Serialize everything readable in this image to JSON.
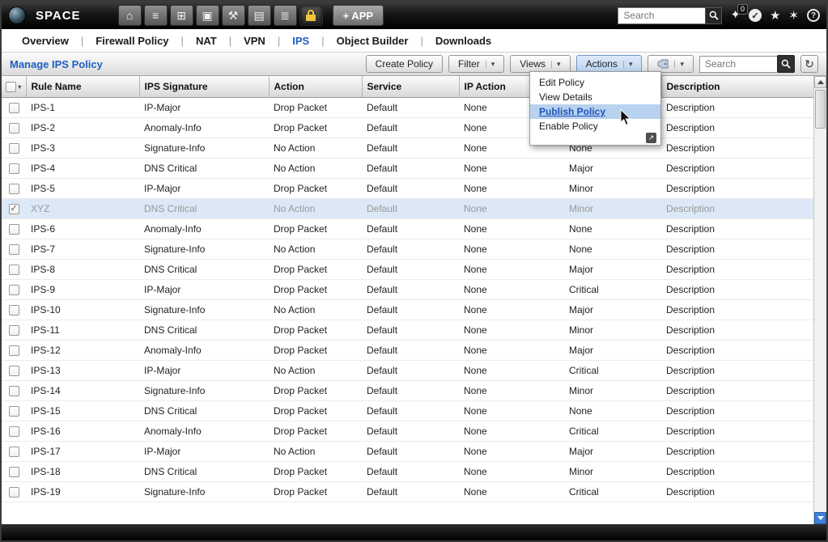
{
  "topbar": {
    "brand": "SPACE",
    "app_button": "+ APP",
    "search_placeholder": "Search",
    "badge": "0"
  },
  "icons": {
    "home": "⌂",
    "list": "≡",
    "screens": "⊞",
    "snapshot": "▣",
    "tools": "⚒",
    "report": "▤",
    "rack": "≣",
    "sparkle": "✦",
    "check": "✓",
    "star": "★",
    "star2": "✶",
    "help": "?",
    "refresh": "↻",
    "dropdown_arrow": "▾",
    "external": "↗"
  },
  "nav": {
    "separator": "|",
    "items": [
      {
        "label": "Overview",
        "active": false
      },
      {
        "label": "Firewall Policy",
        "active": false
      },
      {
        "label": "NAT",
        "active": false
      },
      {
        "label": "VPN",
        "active": false
      },
      {
        "label": "IPS",
        "active": true
      },
      {
        "label": "Object Builder",
        "active": false
      },
      {
        "label": "Downloads",
        "active": false
      }
    ]
  },
  "toolbar": {
    "title": "Manage IPS Policy",
    "create_button": "Create Policy",
    "filter_button": "Filter",
    "views_button": "Views",
    "actions_button": "Actions",
    "search_placeholder": "Search"
  },
  "actions_menu": {
    "items": [
      {
        "label": "Edit Policy",
        "highlighted": false
      },
      {
        "label": "View Details",
        "highlighted": false
      },
      {
        "label": "Publish Policy",
        "highlighted": true
      },
      {
        "label": "Enable Policy",
        "highlighted": false
      }
    ]
  },
  "table": {
    "columns": [
      "Rule Name",
      "IPS Signature",
      "Action",
      "Service",
      "IP Action",
      "",
      "Description"
    ],
    "rows": [
      {
        "rule_name": "IPS-1",
        "ips_signature": "IP-Major",
        "action": "Drop Packet",
        "service": "Default",
        "ip_action": "None",
        "severity": "",
        "description": "Description",
        "checked": false,
        "highlighted": false
      },
      {
        "rule_name": "IPS-2",
        "ips_signature": "Anomaly-Info",
        "action": "Drop Packet",
        "service": "Default",
        "ip_action": "None",
        "severity": "",
        "description": "Description",
        "checked": false,
        "highlighted": false
      },
      {
        "rule_name": "IPS-3",
        "ips_signature": "Signature-Info",
        "action": "No Action",
        "service": "Default",
        "ip_action": "None",
        "severity": "None",
        "description": "Description",
        "checked": false,
        "highlighted": false
      },
      {
        "rule_name": "IPS-4",
        "ips_signature": "DNS Critical",
        "action": "No Action",
        "service": "Default",
        "ip_action": "None",
        "severity": "Major",
        "description": "Description",
        "checked": false,
        "highlighted": false
      },
      {
        "rule_name": "IPS-5",
        "ips_signature": "IP-Major",
        "action": "Drop Packet",
        "service": "Default",
        "ip_action": "None",
        "severity": "Minor",
        "description": "Description",
        "checked": false,
        "highlighted": false
      },
      {
        "rule_name": "XYZ",
        "ips_signature": "DNS Critical",
        "action": "No Action",
        "service": "Default",
        "ip_action": "None",
        "severity": "Minor",
        "description": "Description",
        "checked": true,
        "highlighted": true
      },
      {
        "rule_name": "IPS-6",
        "ips_signature": "Anomaly-Info",
        "action": "Drop Packet",
        "service": "Default",
        "ip_action": "None",
        "severity": "None",
        "description": "Description",
        "checked": false,
        "highlighted": false
      },
      {
        "rule_name": "IPS-7",
        "ips_signature": "Signature-Info",
        "action": "No Action",
        "service": "Default",
        "ip_action": "None",
        "severity": "None",
        "description": "Description",
        "checked": false,
        "highlighted": false
      },
      {
        "rule_name": "IPS-8",
        "ips_signature": "DNS Critical",
        "action": "Drop Packet",
        "service": "Default",
        "ip_action": "None",
        "severity": "Major",
        "description": "Description",
        "checked": false,
        "highlighted": false
      },
      {
        "rule_name": "IPS-9",
        "ips_signature": "IP-Major",
        "action": "Drop Packet",
        "service": "Default",
        "ip_action": "None",
        "severity": "Critical",
        "description": "Description",
        "checked": false,
        "highlighted": false
      },
      {
        "rule_name": "IPS-10",
        "ips_signature": "Signature-Info",
        "action": "No Action",
        "service": "Default",
        "ip_action": "None",
        "severity": "Major",
        "description": "Description",
        "checked": false,
        "highlighted": false
      },
      {
        "rule_name": "IPS-11",
        "ips_signature": "DNS Critical",
        "action": "Drop Packet",
        "service": "Default",
        "ip_action": "None",
        "severity": "Minor",
        "description": "Description",
        "checked": false,
        "highlighted": false
      },
      {
        "rule_name": "IPS-12",
        "ips_signature": "Anomaly-Info",
        "action": "Drop Packet",
        "service": "Default",
        "ip_action": "None",
        "severity": "Major",
        "description": "Description",
        "checked": false,
        "highlighted": false
      },
      {
        "rule_name": "IPS-13",
        "ips_signature": "IP-Major",
        "action": "No Action",
        "service": "Default",
        "ip_action": "None",
        "severity": "Critical",
        "description": "Description",
        "checked": false,
        "highlighted": false
      },
      {
        "rule_name": "IPS-14",
        "ips_signature": "Signature-Info",
        "action": "Drop Packet",
        "service": "Default",
        "ip_action": "None",
        "severity": "Minor",
        "description": "Description",
        "checked": false,
        "highlighted": false
      },
      {
        "rule_name": "IPS-15",
        "ips_signature": "DNS Critical",
        "action": "Drop Packet",
        "service": "Default",
        "ip_action": "None",
        "severity": "None",
        "description": "Description",
        "checked": false,
        "highlighted": false
      },
      {
        "rule_name": "IPS-16",
        "ips_signature": "Anomaly-Info",
        "action": "Drop Packet",
        "service": "Default",
        "ip_action": "None",
        "severity": "Critical",
        "description": "Description",
        "checked": false,
        "highlighted": false
      },
      {
        "rule_name": "IPS-17",
        "ips_signature": "IP-Major",
        "action": "No Action",
        "service": "Default",
        "ip_action": "None",
        "severity": "Major",
        "description": "Description",
        "checked": false,
        "highlighted": false
      },
      {
        "rule_name": "IPS-18",
        "ips_signature": "DNS Critical",
        "action": "Drop Packet",
        "service": "Default",
        "ip_action": "None",
        "severity": "Minor",
        "description": "Description",
        "checked": false,
        "highlighted": false
      },
      {
        "rule_name": "IPS-19",
        "ips_signature": "Signature-Info",
        "action": "Drop Packet",
        "service": "Default",
        "ip_action": "None",
        "severity": "Critical",
        "description": "Description",
        "checked": false,
        "highlighted": false
      }
    ]
  }
}
